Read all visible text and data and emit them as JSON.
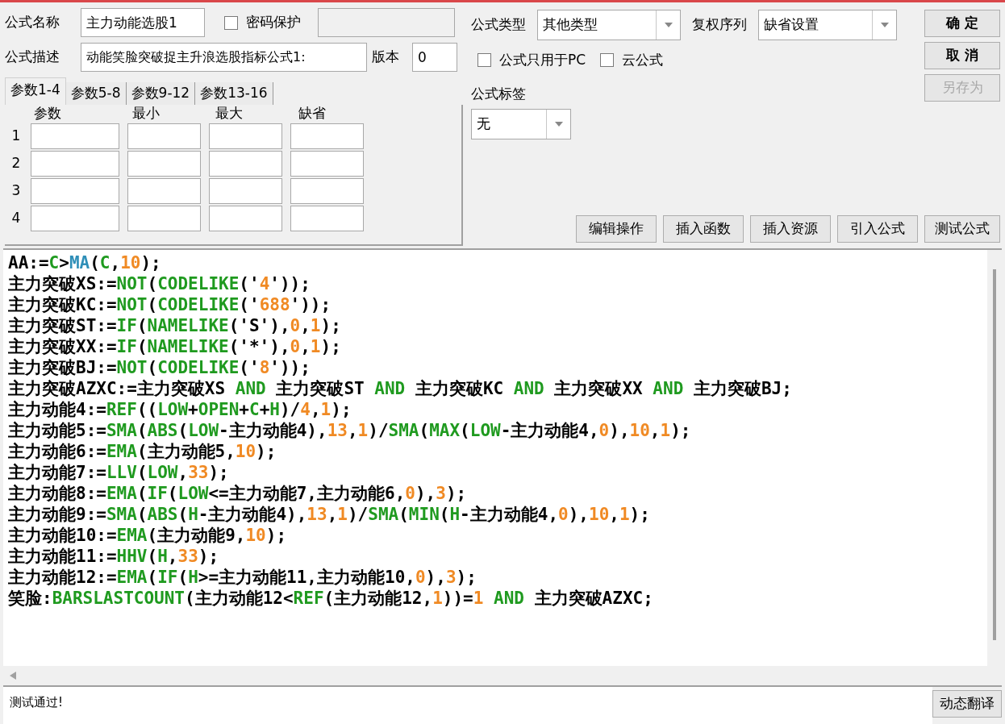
{
  "form": {
    "name_label": "公式名称",
    "name_value": "主力动能选股1",
    "password": {
      "label": "密码保护",
      "checked": false
    },
    "description_label": "公式描述",
    "description_value": "动能笑脸突破捉主升浪选股指标公式1:",
    "version_label": "版本",
    "version_value": "0"
  },
  "param_tabs": [
    {
      "label": "参数1-4",
      "selected": true
    },
    {
      "label": "参数5-8",
      "selected": false
    },
    {
      "label": "参数9-12",
      "selected": false
    },
    {
      "label": "参数13-16",
      "selected": false
    }
  ],
  "param_table": {
    "columns": [
      "参数",
      "最小",
      "最大",
      "缺省"
    ],
    "rows": [
      "1",
      "2",
      "3",
      "4"
    ]
  },
  "formula_type": {
    "label": "公式类型",
    "value": "其他类型"
  },
  "adjust_series": {
    "label": "复权序列",
    "value": "缺省设置"
  },
  "options": [
    {
      "label": "公式只用于PC",
      "checked": false
    },
    {
      "label": "云公式",
      "checked": false
    }
  ],
  "formula_tag": {
    "label": "公式标签",
    "value": "无"
  },
  "dialog_buttons": [
    {
      "label": "确 定",
      "disabled": false
    },
    {
      "label": "取 消",
      "disabled": false
    },
    {
      "label": "另存为",
      "disabled": true
    }
  ],
  "tool_buttons": [
    "编辑操作",
    "插入函数",
    "插入资源",
    "引入公式",
    "测试公式"
  ],
  "code_lines": [
    [
      {
        "kind": "plain",
        "text": "AA:="
      },
      {
        "kind": "func",
        "text": "C"
      },
      {
        "kind": "plain",
        "text": ">"
      },
      {
        "kind": "builtin",
        "text": "MA"
      },
      {
        "kind": "plain",
        "text": "("
      },
      {
        "kind": "func",
        "text": "C"
      },
      {
        "kind": "plain",
        "text": ","
      },
      {
        "kind": "num",
        "text": "10"
      },
      {
        "kind": "plain",
        "text": ");"
      }
    ],
    [
      {
        "kind": "plain",
        "text": "主力突破XS:="
      },
      {
        "kind": "func",
        "text": "NOT"
      },
      {
        "kind": "plain",
        "text": "("
      },
      {
        "kind": "func",
        "text": "CODELIKE"
      },
      {
        "kind": "plain",
        "text": "('"
      },
      {
        "kind": "num",
        "text": "4"
      },
      {
        "kind": "plain",
        "text": "'));"
      }
    ],
    [
      {
        "kind": "plain",
        "text": "主力突破KC:="
      },
      {
        "kind": "func",
        "text": "NOT"
      },
      {
        "kind": "plain",
        "text": "("
      },
      {
        "kind": "func",
        "text": "CODELIKE"
      },
      {
        "kind": "plain",
        "text": "('"
      },
      {
        "kind": "num",
        "text": "688"
      },
      {
        "kind": "plain",
        "text": "'));"
      }
    ],
    [
      {
        "kind": "plain",
        "text": "主力突破ST:="
      },
      {
        "kind": "func",
        "text": "IF"
      },
      {
        "kind": "plain",
        "text": "("
      },
      {
        "kind": "func",
        "text": "NAMELIKE"
      },
      {
        "kind": "plain",
        "text": "('S'),"
      },
      {
        "kind": "num",
        "text": "0"
      },
      {
        "kind": "plain",
        "text": ","
      },
      {
        "kind": "num",
        "text": "1"
      },
      {
        "kind": "plain",
        "text": ");"
      }
    ],
    [
      {
        "kind": "plain",
        "text": "主力突破XX:="
      },
      {
        "kind": "func",
        "text": "IF"
      },
      {
        "kind": "plain",
        "text": "("
      },
      {
        "kind": "func",
        "text": "NAMELIKE"
      },
      {
        "kind": "plain",
        "text": "('*'),"
      },
      {
        "kind": "num",
        "text": "0"
      },
      {
        "kind": "plain",
        "text": ","
      },
      {
        "kind": "num",
        "text": "1"
      },
      {
        "kind": "plain",
        "text": ");"
      }
    ],
    [
      {
        "kind": "plain",
        "text": "主力突破BJ:="
      },
      {
        "kind": "func",
        "text": "NOT"
      },
      {
        "kind": "plain",
        "text": "("
      },
      {
        "kind": "func",
        "text": "CODELIKE"
      },
      {
        "kind": "plain",
        "text": "('"
      },
      {
        "kind": "num",
        "text": "8"
      },
      {
        "kind": "plain",
        "text": "'));"
      }
    ],
    [
      {
        "kind": "plain",
        "text": "主力突破AZXC:=主力突破XS "
      },
      {
        "kind": "func",
        "text": "AND"
      },
      {
        "kind": "plain",
        "text": " 主力突破ST "
      },
      {
        "kind": "func",
        "text": "AND"
      },
      {
        "kind": "plain",
        "text": " 主力突破KC "
      },
      {
        "kind": "func",
        "text": "AND"
      },
      {
        "kind": "plain",
        "text": " 主力突破XX "
      },
      {
        "kind": "func",
        "text": "AND"
      },
      {
        "kind": "plain",
        "text": " 主力突破BJ;"
      }
    ],
    [
      {
        "kind": "plain",
        "text": "主力动能4:="
      },
      {
        "kind": "func",
        "text": "REF"
      },
      {
        "kind": "plain",
        "text": "(("
      },
      {
        "kind": "func",
        "text": "LOW"
      },
      {
        "kind": "plain",
        "text": "+"
      },
      {
        "kind": "func",
        "text": "OPEN"
      },
      {
        "kind": "plain",
        "text": "+"
      },
      {
        "kind": "func",
        "text": "C"
      },
      {
        "kind": "plain",
        "text": "+"
      },
      {
        "kind": "func",
        "text": "H"
      },
      {
        "kind": "plain",
        "text": ")/"
      },
      {
        "kind": "num",
        "text": "4"
      },
      {
        "kind": "plain",
        "text": ","
      },
      {
        "kind": "num",
        "text": "1"
      },
      {
        "kind": "plain",
        "text": ");"
      }
    ],
    [
      {
        "kind": "plain",
        "text": "主力动能5:="
      },
      {
        "kind": "func",
        "text": "SMA"
      },
      {
        "kind": "plain",
        "text": "("
      },
      {
        "kind": "func",
        "text": "ABS"
      },
      {
        "kind": "plain",
        "text": "("
      },
      {
        "kind": "func",
        "text": "LOW"
      },
      {
        "kind": "plain",
        "text": "-主力动能4),"
      },
      {
        "kind": "num",
        "text": "13"
      },
      {
        "kind": "plain",
        "text": ","
      },
      {
        "kind": "num",
        "text": "1"
      },
      {
        "kind": "plain",
        "text": ")/"
      },
      {
        "kind": "func",
        "text": "SMA"
      },
      {
        "kind": "plain",
        "text": "("
      },
      {
        "kind": "func",
        "text": "MAX"
      },
      {
        "kind": "plain",
        "text": "("
      },
      {
        "kind": "func",
        "text": "LOW"
      },
      {
        "kind": "plain",
        "text": "-主力动能4,"
      },
      {
        "kind": "num",
        "text": "0"
      },
      {
        "kind": "plain",
        "text": "),"
      },
      {
        "kind": "num",
        "text": "10"
      },
      {
        "kind": "plain",
        "text": ","
      },
      {
        "kind": "num",
        "text": "1"
      },
      {
        "kind": "plain",
        "text": ");"
      }
    ],
    [
      {
        "kind": "plain",
        "text": "主力动能6:="
      },
      {
        "kind": "func",
        "text": "EMA"
      },
      {
        "kind": "plain",
        "text": "(主力动能5,"
      },
      {
        "kind": "num",
        "text": "10"
      },
      {
        "kind": "plain",
        "text": ");"
      }
    ],
    [
      {
        "kind": "plain",
        "text": "主力动能7:="
      },
      {
        "kind": "func",
        "text": "LLV"
      },
      {
        "kind": "plain",
        "text": "("
      },
      {
        "kind": "func",
        "text": "LOW"
      },
      {
        "kind": "plain",
        "text": ","
      },
      {
        "kind": "num",
        "text": "33"
      },
      {
        "kind": "plain",
        "text": ");"
      }
    ],
    [
      {
        "kind": "plain",
        "text": "主力动能8:="
      },
      {
        "kind": "func",
        "text": "EMA"
      },
      {
        "kind": "plain",
        "text": "("
      },
      {
        "kind": "func",
        "text": "IF"
      },
      {
        "kind": "plain",
        "text": "("
      },
      {
        "kind": "func",
        "text": "LOW"
      },
      {
        "kind": "plain",
        "text": "<=主力动能7,主力动能6,"
      },
      {
        "kind": "num",
        "text": "0"
      },
      {
        "kind": "plain",
        "text": "),"
      },
      {
        "kind": "num",
        "text": "3"
      },
      {
        "kind": "plain",
        "text": ");"
      }
    ],
    [
      {
        "kind": "plain",
        "text": "主力动能9:="
      },
      {
        "kind": "func",
        "text": "SMA"
      },
      {
        "kind": "plain",
        "text": "("
      },
      {
        "kind": "func",
        "text": "ABS"
      },
      {
        "kind": "plain",
        "text": "("
      },
      {
        "kind": "func",
        "text": "H"
      },
      {
        "kind": "plain",
        "text": "-主力动能4),"
      },
      {
        "kind": "num",
        "text": "13"
      },
      {
        "kind": "plain",
        "text": ","
      },
      {
        "kind": "num",
        "text": "1"
      },
      {
        "kind": "plain",
        "text": ")/"
      },
      {
        "kind": "func",
        "text": "SMA"
      },
      {
        "kind": "plain",
        "text": "("
      },
      {
        "kind": "func",
        "text": "MIN"
      },
      {
        "kind": "plain",
        "text": "("
      },
      {
        "kind": "func",
        "text": "H"
      },
      {
        "kind": "plain",
        "text": "-主力动能4,"
      },
      {
        "kind": "num",
        "text": "0"
      },
      {
        "kind": "plain",
        "text": "),"
      },
      {
        "kind": "num",
        "text": "10"
      },
      {
        "kind": "plain",
        "text": ","
      },
      {
        "kind": "num",
        "text": "1"
      },
      {
        "kind": "plain",
        "text": ");"
      }
    ],
    [
      {
        "kind": "plain",
        "text": "主力动能10:="
      },
      {
        "kind": "func",
        "text": "EMA"
      },
      {
        "kind": "plain",
        "text": "(主力动能9,"
      },
      {
        "kind": "num",
        "text": "10"
      },
      {
        "kind": "plain",
        "text": ");"
      }
    ],
    [
      {
        "kind": "plain",
        "text": "主力动能11:="
      },
      {
        "kind": "func",
        "text": "HHV"
      },
      {
        "kind": "plain",
        "text": "("
      },
      {
        "kind": "func",
        "text": "H"
      },
      {
        "kind": "plain",
        "text": ","
      },
      {
        "kind": "num",
        "text": "33"
      },
      {
        "kind": "plain",
        "text": ");"
      }
    ],
    [
      {
        "kind": "plain",
        "text": "主力动能12:="
      },
      {
        "kind": "func",
        "text": "EMA"
      },
      {
        "kind": "plain",
        "text": "("
      },
      {
        "kind": "func",
        "text": "IF"
      },
      {
        "kind": "plain",
        "text": "("
      },
      {
        "kind": "func",
        "text": "H"
      },
      {
        "kind": "plain",
        "text": ">=主力动能11,主力动能10,"
      },
      {
        "kind": "num",
        "text": "0"
      },
      {
        "kind": "plain",
        "text": "),"
      },
      {
        "kind": "num",
        "text": "3"
      },
      {
        "kind": "plain",
        "text": ");"
      }
    ],
    [
      {
        "kind": "plain",
        "text": "笑脸:"
      },
      {
        "kind": "func",
        "text": "BARSLASTCOUNT"
      },
      {
        "kind": "plain",
        "text": "(主力动能12<"
      },
      {
        "kind": "func",
        "text": "REF"
      },
      {
        "kind": "plain",
        "text": "(主力动能12,"
      },
      {
        "kind": "num",
        "text": "1"
      },
      {
        "kind": "plain",
        "text": "))="
      },
      {
        "kind": "num",
        "text": "1"
      },
      {
        "kind": "func",
        "text": " AND"
      },
      {
        "kind": "plain",
        "text": " 主力突破AZXC;"
      }
    ]
  ],
  "status": {
    "message": "测试通过!",
    "button": "动态翻译"
  }
}
